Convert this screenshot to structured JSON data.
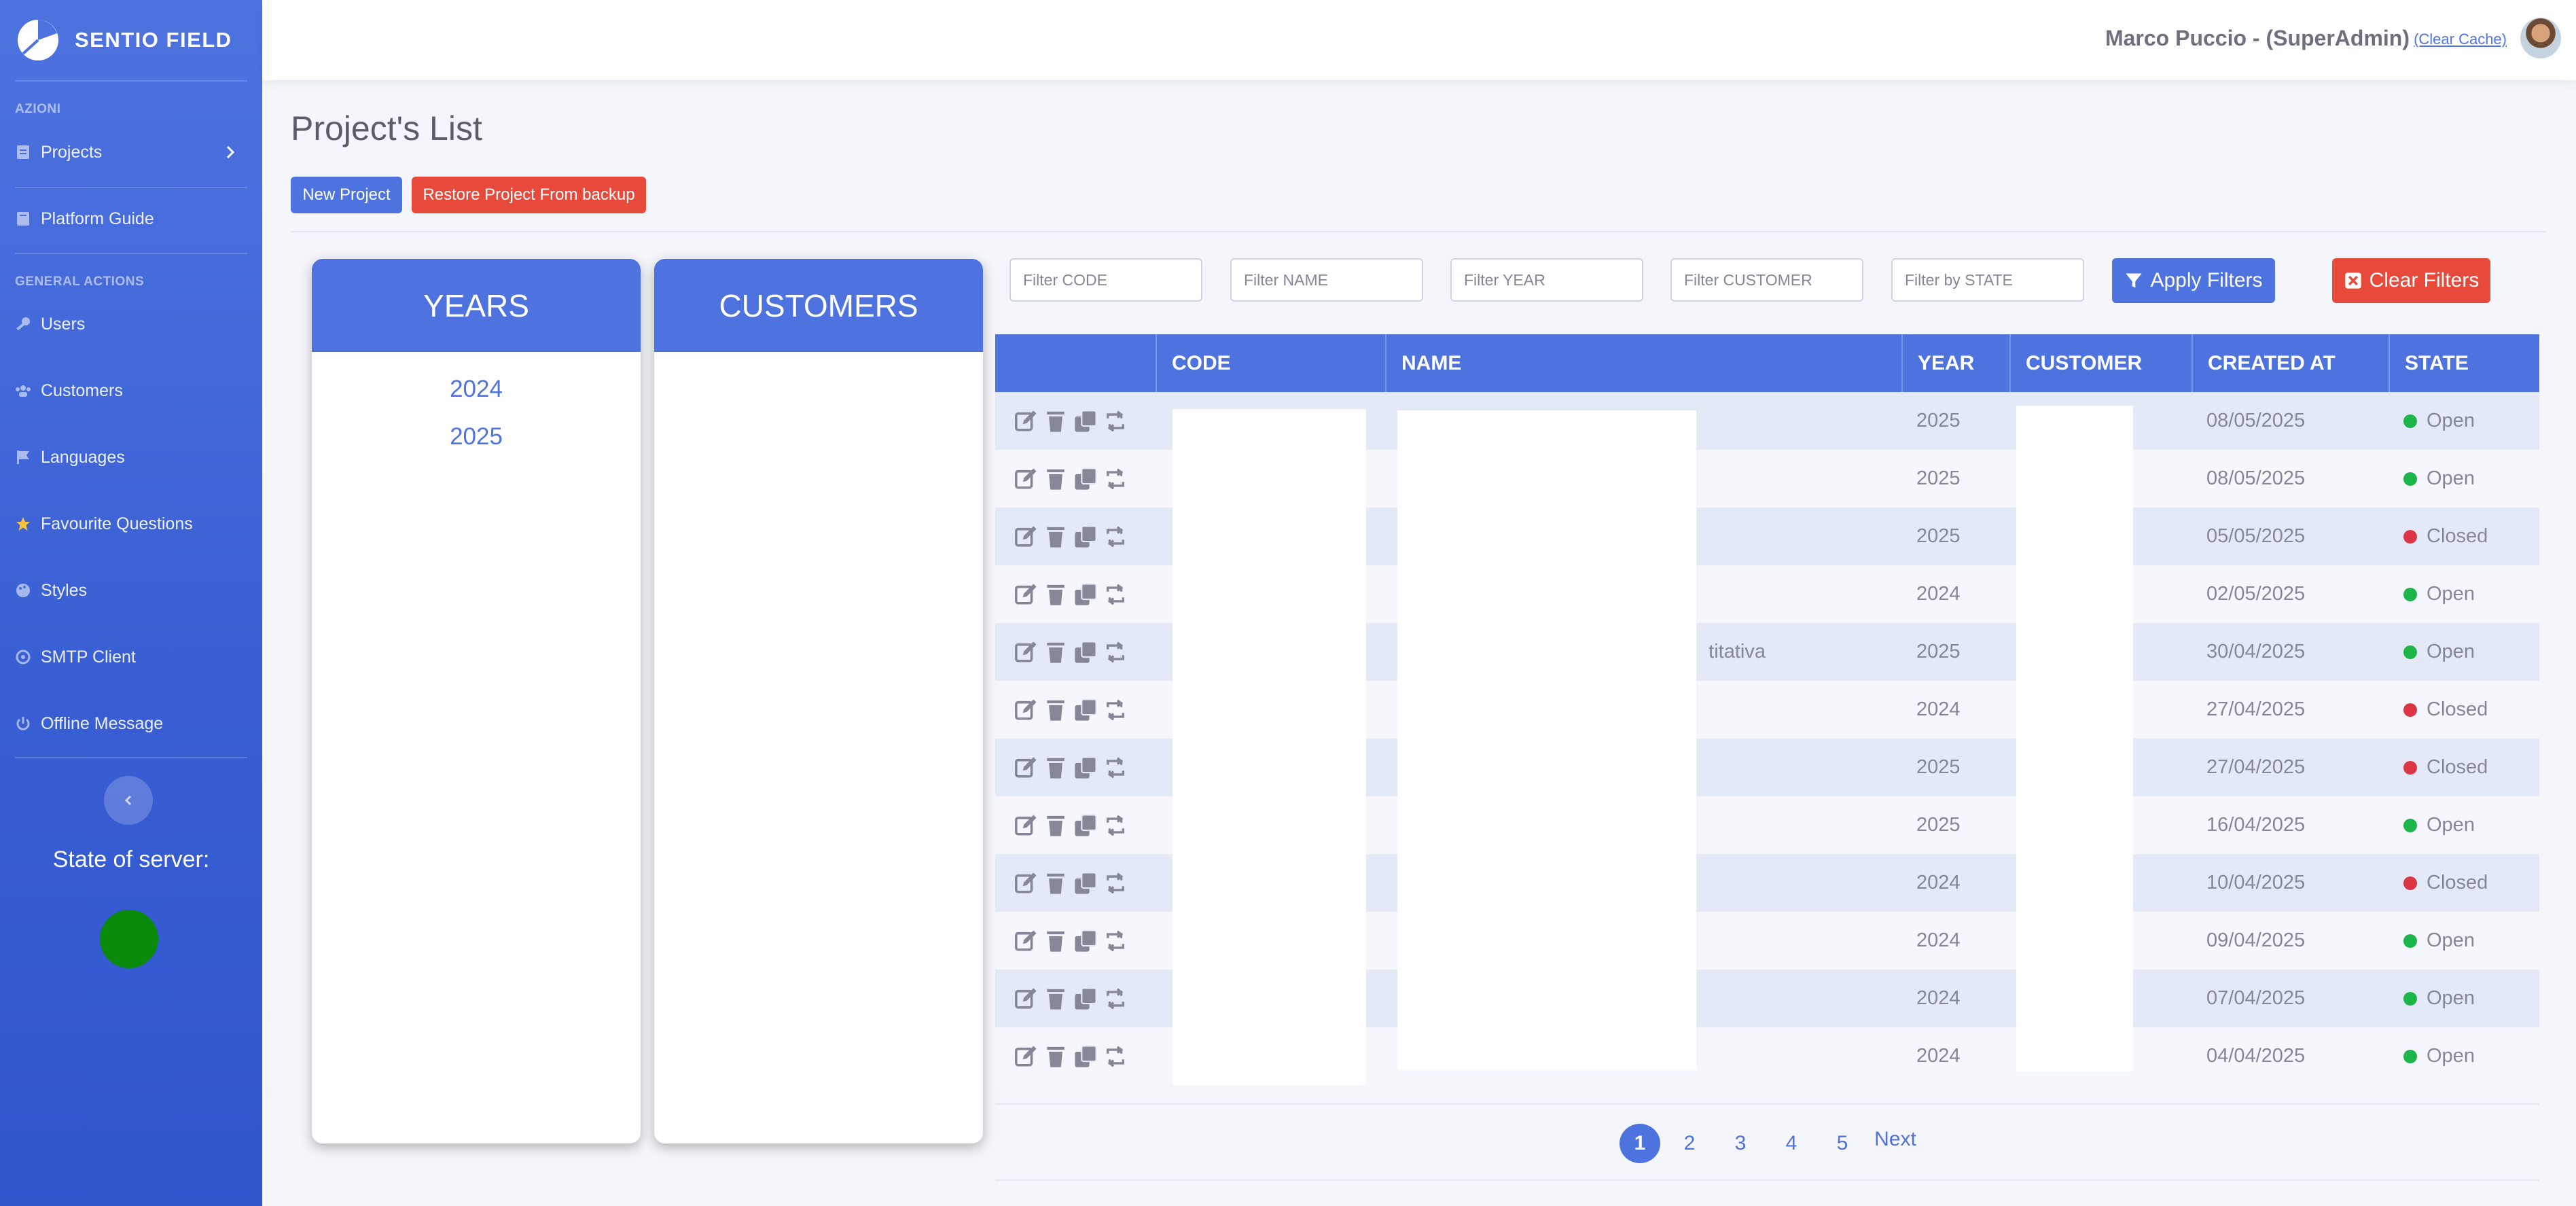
{
  "app": {
    "brand": "SENTIO FIELD"
  },
  "sidebar": {
    "heading_azioni": "AZIONI",
    "heading_general": "GENERAL ACTIONS",
    "items": [
      {
        "label": "Projects",
        "icon": "file-icon"
      },
      {
        "label": "Platform Guide",
        "icon": "book-icon"
      },
      {
        "label": "Users",
        "icon": "key-icon"
      },
      {
        "label": "Customers",
        "icon": "users-icon"
      },
      {
        "label": "Languages",
        "icon": "flag-icon"
      },
      {
        "label": "Favourite Questions",
        "icon": "star-icon"
      },
      {
        "label": "Styles",
        "icon": "palette-icon"
      },
      {
        "label": "SMTP Client",
        "icon": "at-icon"
      },
      {
        "label": "Offline Message",
        "icon": "power-icon"
      }
    ],
    "server_state_label": "State of server:",
    "server_state_color": "#0a8a0a"
  },
  "topbar": {
    "user": "Marco Puccio - (SuperAdmin)",
    "clear_cache": "(Clear Cache)"
  },
  "page": {
    "title": "Project's List",
    "new_project": "New Project",
    "restore_project": "Restore Project From backup"
  },
  "years_panel": {
    "title": "YEARS",
    "years": [
      "2024",
      "2025"
    ]
  },
  "customers_panel": {
    "title": "CUSTOMERS"
  },
  "filters": {
    "code_placeholder": "Filter CODE",
    "name_placeholder": "Filter NAME",
    "year_placeholder": "Filter YEAR",
    "customer_placeholder": "Filter CUSTOMER",
    "state_placeholder": "Filter by STATE",
    "apply": "Apply Filters",
    "clear": "Clear Filters"
  },
  "table": {
    "columns": [
      "",
      "CODE",
      "NAME",
      "YEAR",
      "CUSTOMER",
      "CREATED AT",
      "STATE"
    ],
    "rows": [
      {
        "name": "",
        "year": "2025",
        "created_at": "08/05/2025",
        "state": "Open"
      },
      {
        "name": "",
        "year": "2025",
        "created_at": "08/05/2025",
        "state": "Open"
      },
      {
        "name": "",
        "year": "2025",
        "created_at": "05/05/2025",
        "state": "Closed"
      },
      {
        "name": "",
        "year": "2024",
        "created_at": "02/05/2025",
        "state": "Open"
      },
      {
        "name": "titativa",
        "year": "2025",
        "created_at": "30/04/2025",
        "state": "Open"
      },
      {
        "name": "",
        "year": "2024",
        "created_at": "27/04/2025",
        "state": "Closed"
      },
      {
        "name": "",
        "year": "2025",
        "created_at": "27/04/2025",
        "state": "Closed"
      },
      {
        "name": "",
        "year": "2025",
        "created_at": "16/04/2025",
        "state": "Open"
      },
      {
        "name": "",
        "year": "2024",
        "created_at": "10/04/2025",
        "state": "Closed"
      },
      {
        "name": "",
        "year": "2024",
        "created_at": "09/04/2025",
        "state": "Open"
      },
      {
        "name": "",
        "year": "2024",
        "created_at": "07/04/2025",
        "state": "Open"
      },
      {
        "name": "",
        "year": "2024",
        "created_at": "04/04/2025",
        "state": "Open"
      }
    ]
  },
  "pagination": {
    "pages": [
      "1",
      "2",
      "3",
      "4",
      "5"
    ],
    "next": "Next",
    "active": "1"
  },
  "colors": {
    "accent": "#4e73df",
    "danger": "#e74a3b",
    "open": "#1cb54a",
    "closed": "#dc3545"
  }
}
